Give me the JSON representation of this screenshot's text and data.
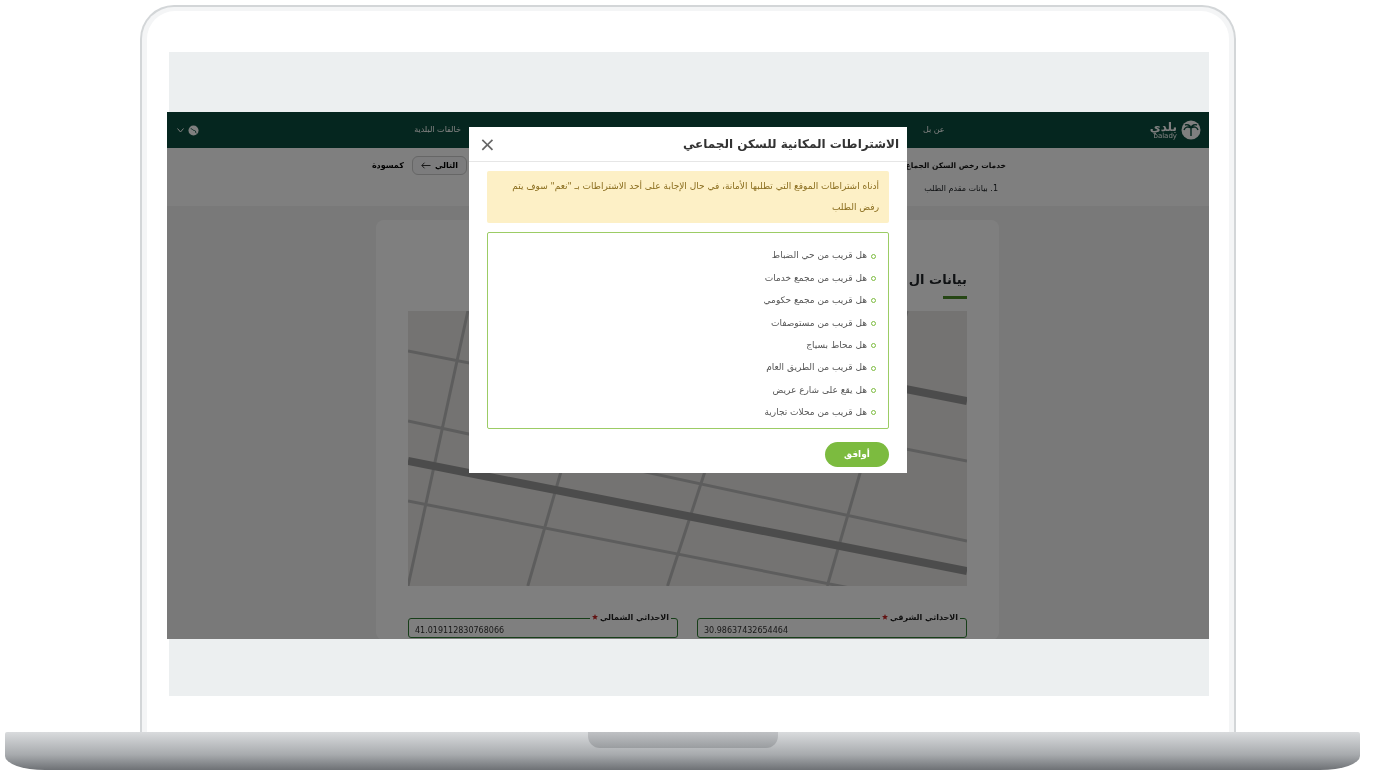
{
  "navbar": {
    "logo": {
      "text": "بلدي",
      "subtext": "balady"
    },
    "items": [
      {
        "label": "عن بل"
      },
      {
        "label": "خالفات البلدية"
      }
    ]
  },
  "page": {
    "title": "خدمات رخص السكن الجماع",
    "buttons": [
      {
        "label": "التالي",
        "kind": "next"
      },
      {
        "label": "كمسودة",
        "kind": "draft"
      }
    ],
    "steps": [
      {
        "number": "1.",
        "label": "بيانات مقدم الطلب"
      }
    ]
  },
  "card": {
    "heading": "بيانات ال",
    "fields": [
      {
        "label": "الاحداثي الشرقي",
        "required": true,
        "value": "30.98637432654464"
      },
      {
        "label": "الاحداثي الشمالي",
        "required": true,
        "value": "41.019112830768066"
      }
    ]
  },
  "modal": {
    "title": "الاشتراطات المكانية للسكن الجماعي",
    "close": "×",
    "alert": "أدناه اشتراطات الموقع التي تطلبها الأمانة، في حال الإجابة على أحد الاشتراطات بـ \"نعم\" سوف يتم رفض الطلب",
    "conditions": [
      "هل قريب من حي الضباط",
      "هل قريب من مجمع خدمات",
      "هل قريب من مجمع حكومي",
      "هل قريب من مستوصفات",
      "هل محاط بسياج",
      "هل قريب من الطريق العام",
      "هل يقع على شارع عريض",
      "هل قريب من محلات تجارية"
    ],
    "button": "أوافق"
  }
}
